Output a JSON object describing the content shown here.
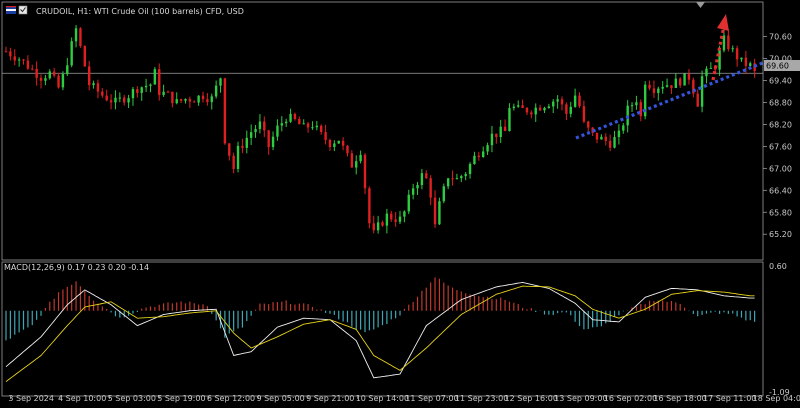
{
  "header": {
    "symbol_text": "CRUDOIL, H1: WTI Crude Oil (100 barrels) CFD, USD",
    "icon": "flag-icon"
  },
  "colors": {
    "background": "#000000",
    "bull": "#2ecc40",
    "bear": "#e02020",
    "grid": "#2a2a2a",
    "axis_text": "#c8c8c8",
    "trend_line": "#3355dd",
    "arrow": "#e03030",
    "macd_pos": "#c0392b",
    "macd_neg": "#3fa7b5",
    "signal": "#e6d21a",
    "macd_line": "#f0f0f0",
    "price_line": "#a0a0a0"
  },
  "chart_data": [
    {
      "type": "candlestick",
      "title": "CRUDOIL, H1: WTI Crude Oil (100 barrels) CFD, USD",
      "ylim": [
        64.55,
        71.0
      ],
      "y_ticks": [
        70.6,
        70.0,
        69.4,
        68.8,
        68.2,
        67.6,
        67.0,
        66.4,
        65.8,
        65.2
      ],
      "current_price": 69.6,
      "current_price_label": "69.60",
      "x_ticks": [
        "3 Sep 2024",
        "4 Sep 10:00",
        "5 Sep 03:00",
        "5 Sep 19:00",
        "6 Sep 12:00",
        "9 Sep 05:00",
        "9 Sep 21:00",
        "10 Sep 14:00",
        "11 Sep 07:00",
        "11 Sep 23:00",
        "12 Sep 16:00",
        "13 Sep 09:00",
        "16 Sep 02:00",
        "16 Sep 18:00",
        "17 Sep 11:00",
        "18 Sep 04:00"
      ],
      "close_path": [
        [
          0,
          70.2
        ],
        [
          3,
          70.0
        ],
        [
          5,
          69.8
        ],
        [
          8,
          69.5
        ],
        [
          10,
          69.6
        ],
        [
          12,
          69.2
        ],
        [
          13,
          69.5
        ],
        [
          16,
          70.8
        ],
        [
          18,
          69.8
        ],
        [
          19,
          69.3
        ],
        [
          22,
          69.0
        ],
        [
          25,
          68.8
        ],
        [
          28,
          69.0
        ],
        [
          30,
          69.2
        ],
        [
          33,
          69.3
        ],
        [
          34,
          69.6
        ],
        [
          35,
          69.1
        ],
        [
          37,
          69.0
        ],
        [
          39,
          68.8
        ],
        [
          41,
          68.9
        ],
        [
          43,
          68.9
        ],
        [
          45,
          69.0
        ],
        [
          47,
          68.9
        ],
        [
          48,
          69.2
        ],
        [
          49,
          69.5
        ],
        [
          50,
          67.8
        ],
        [
          52,
          67.0
        ],
        [
          53,
          67.5
        ],
        [
          56,
          68.0
        ],
        [
          58,
          68.2
        ],
        [
          60,
          67.6
        ],
        [
          62,
          68.1
        ],
        [
          64,
          68.4
        ],
        [
          66,
          68.3
        ],
        [
          68,
          68.1
        ],
        [
          70,
          68.2
        ],
        [
          72,
          67.9
        ],
        [
          74,
          67.7
        ],
        [
          76,
          67.8
        ],
        [
          78,
          67.3
        ],
        [
          79,
          67.1
        ],
        [
          81,
          67.5
        ],
        [
          83,
          65.5
        ],
        [
          84,
          65.2
        ],
        [
          85,
          65.4
        ],
        [
          87,
          65.7
        ],
        [
          90,
          65.6
        ],
        [
          91,
          65.8
        ],
        [
          93,
          66.5
        ],
        [
          95,
          66.8
        ],
        [
          96,
          66.7
        ],
        [
          97,
          66.3
        ],
        [
          98,
          65.4
        ],
        [
          99,
          66.0
        ],
        [
          101,
          66.8
        ],
        [
          103,
          66.7
        ],
        [
          105,
          66.9
        ],
        [
          107,
          67.3
        ],
        [
          109,
          67.6
        ],
        [
          111,
          67.9
        ],
        [
          113,
          68.0
        ],
        [
          114,
          68.0
        ],
        [
          115,
          68.7
        ],
        [
          117,
          68.6
        ],
        [
          120,
          68.6
        ],
        [
          122,
          68.7
        ],
        [
          124,
          68.8
        ],
        [
          126,
          68.9
        ],
        [
          128,
          68.5
        ],
        [
          130,
          69.0
        ],
        [
          131,
          68.7
        ],
        [
          132,
          68.2
        ],
        [
          134,
          67.9
        ],
        [
          136,
          67.8
        ],
        [
          138,
          67.7
        ],
        [
          140,
          67.9
        ],
        [
          142,
          68.6
        ],
        [
          144,
          68.9
        ],
        [
          145,
          68.4
        ],
        [
          146,
          69.4
        ],
        [
          148,
          69.2
        ],
        [
          150,
          69.3
        ],
        [
          152,
          69.3
        ],
        [
          154,
          69.4
        ],
        [
          156,
          69.5
        ],
        [
          158,
          68.8
        ],
        [
          159,
          69.5
        ],
        [
          161,
          69.7
        ],
        [
          162,
          69.8
        ],
        [
          164,
          70.5
        ],
        [
          166,
          70.2
        ],
        [
          168,
          69.9
        ],
        [
          170,
          69.8
        ],
        [
          171,
          69.6
        ]
      ]
    },
    {
      "type": "line",
      "title": "MACD(12,26,9) 0.17 0.23 0.20 -0.14",
      "ylim": [
        -1.09,
        0.6
      ],
      "y_ticks": [
        0.6,
        -1.09
      ],
      "series": [
        {
          "name": "MACD",
          "points": [
            [
              0,
              -0.75
            ],
            [
              8,
              -0.35
            ],
            [
              14,
              0.08
            ],
            [
              18,
              0.28
            ],
            [
              24,
              0.08
            ],
            [
              30,
              -0.2
            ],
            [
              36,
              -0.05
            ],
            [
              42,
              0.0
            ],
            [
              48,
              0.02
            ],
            [
              52,
              -0.6
            ],
            [
              56,
              -0.55
            ],
            [
              62,
              -0.22
            ],
            [
              68,
              -0.1
            ],
            [
              74,
              -0.12
            ],
            [
              80,
              -0.4
            ],
            [
              84,
              -0.9
            ],
            [
              90,
              -0.85
            ],
            [
              96,
              -0.2
            ],
            [
              104,
              0.15
            ],
            [
              112,
              0.32
            ],
            [
              118,
              0.38
            ],
            [
              124,
              0.3
            ],
            [
              130,
              0.1
            ],
            [
              134,
              -0.12
            ],
            [
              140,
              -0.15
            ],
            [
              146,
              0.18
            ],
            [
              152,
              0.3
            ],
            [
              158,
              0.28
            ],
            [
              164,
              0.2
            ],
            [
              170,
              0.17
            ]
          ]
        },
        {
          "name": "Signal",
          "points": [
            [
              0,
              -0.95
            ],
            [
              8,
              -0.6
            ],
            [
              14,
              -0.2
            ],
            [
              18,
              0.05
            ],
            [
              24,
              0.12
            ],
            [
              30,
              -0.1
            ],
            [
              36,
              -0.08
            ],
            [
              42,
              -0.03
            ],
            [
              48,
              0.0
            ],
            [
              52,
              -0.3
            ],
            [
              56,
              -0.5
            ],
            [
              62,
              -0.35
            ],
            [
              68,
              -0.18
            ],
            [
              74,
              -0.12
            ],
            [
              80,
              -0.25
            ],
            [
              84,
              -0.6
            ],
            [
              90,
              -0.8
            ],
            [
              96,
              -0.5
            ],
            [
              104,
              -0.05
            ],
            [
              112,
              0.22
            ],
            [
              118,
              0.33
            ],
            [
              124,
              0.32
            ],
            [
              130,
              0.2
            ],
            [
              134,
              0.02
            ],
            [
              140,
              -0.1
            ],
            [
              146,
              0.02
            ],
            [
              152,
              0.22
            ],
            [
              158,
              0.27
            ],
            [
              164,
              0.25
            ],
            [
              170,
              0.2
            ]
          ]
        },
        {
          "name": "Histogram",
          "points": [
            [
              0,
              -0.4
            ],
            [
              6,
              -0.2
            ],
            [
              12,
              0.25
            ],
            [
              16,
              0.4
            ],
            [
              20,
              0.15
            ],
            [
              26,
              -0.1
            ],
            [
              32,
              0.05
            ],
            [
              40,
              0.12
            ],
            [
              46,
              0.08
            ],
            [
              50,
              -0.35
            ],
            [
              54,
              -0.22
            ],
            [
              58,
              0.08
            ],
            [
              64,
              0.12
            ],
            [
              70,
              0.06
            ],
            [
              76,
              -0.1
            ],
            [
              82,
              -0.3
            ],
            [
              86,
              -0.2
            ],
            [
              90,
              -0.05
            ],
            [
              94,
              0.2
            ],
            [
              98,
              0.45
            ],
            [
              102,
              0.3
            ],
            [
              108,
              0.2
            ],
            [
              114,
              0.15
            ],
            [
              118,
              0.05
            ],
            [
              124,
              -0.05
            ],
            [
              128,
              -0.02
            ],
            [
              132,
              -0.25
            ],
            [
              136,
              -0.22
            ],
            [
              140,
              -0.05
            ],
            [
              144,
              0.05
            ],
            [
              148,
              0.15
            ],
            [
              154,
              0.1
            ],
            [
              158,
              -0.08
            ],
            [
              162,
              -0.02
            ],
            [
              166,
              -0.05
            ],
            [
              170,
              -0.14
            ]
          ]
        }
      ]
    }
  ]
}
